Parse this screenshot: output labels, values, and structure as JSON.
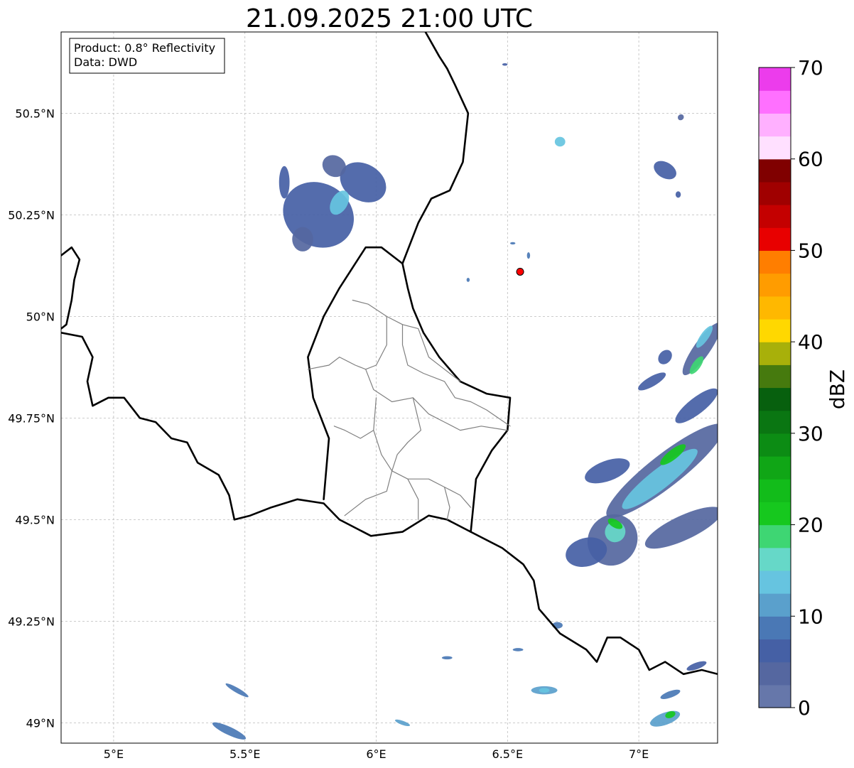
{
  "title": "21.09.2025 21:00 UTC",
  "info_box": {
    "product": "Product: 0.8° Reflectivity",
    "data": "Data: DWD"
  },
  "map": {
    "lon_range": [
      4.8,
      7.3
    ],
    "lat_range": [
      48.95,
      50.7
    ],
    "gridlines": true,
    "x_ticks": [
      {
        "value": 5.0,
        "label": "5°E"
      },
      {
        "value": 5.5,
        "label": "5.5°E"
      },
      {
        "value": 6.0,
        "label": "6°E"
      },
      {
        "value": 6.5,
        "label": "6.5°E"
      },
      {
        "value": 7.0,
        "label": "7°E"
      }
    ],
    "y_ticks": [
      {
        "value": 49.0,
        "label": "49°N"
      },
      {
        "value": 49.25,
        "label": "49.25°N"
      },
      {
        "value": 49.5,
        "label": "49.5°N"
      },
      {
        "value": 49.75,
        "label": "49.75°N"
      },
      {
        "value": 50.0,
        "label": "50°N"
      },
      {
        "value": 50.25,
        "label": "50.25°N"
      },
      {
        "value": 50.5,
        "label": "50.5°N"
      }
    ],
    "radar_site": {
      "lon": 6.548,
      "lat": 50.11,
      "color": "#ff0000"
    }
  },
  "colorbar": {
    "label": "dBZ",
    "min": 0,
    "max": 70,
    "ticks": [
      {
        "value": 0,
        "label": "0"
      },
      {
        "value": 10,
        "label": "10"
      },
      {
        "value": 20,
        "label": "20"
      },
      {
        "value": 30,
        "label": "30"
      },
      {
        "value": 40,
        "label": "40"
      },
      {
        "value": 50,
        "label": "50"
      },
      {
        "value": 60,
        "label": "60"
      },
      {
        "value": 70,
        "label": "70"
      }
    ],
    "colors": [
      "#6677aa",
      "#5567a0",
      "#4560a5",
      "#4a78b5",
      "#5aa0cc",
      "#66c4e0",
      "#66d8c8",
      "#3ed673",
      "#16c81e",
      "#12bc1a",
      "#10a616",
      "#0c8c14",
      "#0a7612",
      "#07600e",
      "#467a0e",
      "#a8b00a",
      "#ffd800",
      "#ffb800",
      "#ff9c00",
      "#ff7e00",
      "#e80000",
      "#c40000",
      "#a00000",
      "#800000",
      "#ffe0ff",
      "#ffb0ff",
      "#ff70ff",
      "#ec3cec"
    ]
  },
  "echoes": [
    {
      "lon": 5.78,
      "lat": 50.25,
      "rlon": 0.12,
      "rlat": 0.09,
      "angle": -60,
      "level": 2
    },
    {
      "lon": 5.95,
      "lat": 50.33,
      "rlon": 0.07,
      "rlat": 0.06,
      "angle": -60,
      "level": 2
    },
    {
      "lon": 5.84,
      "lat": 50.37,
      "rlon": 0.04,
      "rlat": 0.03,
      "angle": -60,
      "level": 1
    },
    {
      "lon": 5.86,
      "lat": 50.28,
      "rlon": 0.05,
      "rlat": 0.02,
      "angle": -60,
      "level": 5
    },
    {
      "lon": 5.65,
      "lat": 50.33,
      "rlon": 0.02,
      "rlat": 0.04,
      "angle": 0,
      "level": 2
    },
    {
      "lon": 5.72,
      "lat": 50.19,
      "rlon": 0.04,
      "rlat": 0.03,
      "angle": 0,
      "level": 1
    },
    {
      "lon": 7.1,
      "lat": 49.62,
      "rlon": 0.28,
      "rlat": 0.04,
      "angle": -38,
      "level": 1
    },
    {
      "lon": 7.22,
      "lat": 49.78,
      "rlon": 0.1,
      "rlat": 0.02,
      "angle": -38,
      "level": 2
    },
    {
      "lon": 7.08,
      "lat": 49.6,
      "rlon": 0.18,
      "rlat": 0.025,
      "angle": -38,
      "level": 5
    },
    {
      "lon": 7.13,
      "lat": 49.66,
      "rlon": 0.06,
      "rlat": 0.012,
      "angle": -38,
      "level": 8
    },
    {
      "lon": 7.24,
      "lat": 49.92,
      "rlon": 0.12,
      "rlat": 0.02,
      "angle": -55,
      "level": 1
    },
    {
      "lon": 7.25,
      "lat": 49.95,
      "rlon": 0.05,
      "rlat": 0.01,
      "angle": -55,
      "level": 5
    },
    {
      "lon": 7.22,
      "lat": 49.88,
      "rlon": 0.04,
      "rlat": 0.01,
      "angle": -55,
      "level": 7
    },
    {
      "lon": 6.9,
      "lat": 49.45,
      "rlon": 0.1,
      "rlat": 0.06,
      "angle": -55,
      "level": 1
    },
    {
      "lon": 6.91,
      "lat": 49.47,
      "rlon": 0.04,
      "rlat": 0.025,
      "angle": -60,
      "level": 6
    },
    {
      "lon": 6.91,
      "lat": 49.49,
      "rlon": 0.015,
      "rlat": 0.02,
      "angle": -60,
      "level": 8
    },
    {
      "lon": 6.8,
      "lat": 49.42,
      "rlon": 0.08,
      "rlat": 0.035,
      "angle": -15,
      "level": 2
    },
    {
      "lon": 6.88,
      "lat": 49.62,
      "rlon": 0.09,
      "rlat": 0.025,
      "angle": -20,
      "level": 2
    },
    {
      "lon": 7.17,
      "lat": 49.48,
      "rlon": 0.16,
      "rlat": 0.03,
      "angle": -25,
      "level": 1
    },
    {
      "lon": 7.05,
      "lat": 49.84,
      "rlon": 0.06,
      "rlat": 0.012,
      "angle": -30,
      "level": 2
    },
    {
      "lon": 7.1,
      "lat": 49.9,
      "rlon": 0.03,
      "rlat": 0.015,
      "angle": -50,
      "level": 2
    },
    {
      "lon": 7.1,
      "lat": 50.36,
      "rlon": 0.03,
      "rlat": 0.03,
      "angle": -60,
      "level": 2
    },
    {
      "lon": 7.16,
      "lat": 50.49,
      "rlon": 0.012,
      "rlat": 0.007,
      "angle": -40,
      "level": 1
    },
    {
      "lon": 7.15,
      "lat": 50.3,
      "rlon": 0.01,
      "rlat": 0.008,
      "angle": 0,
      "level": 2
    },
    {
      "lon": 6.7,
      "lat": 50.43,
      "rlon": 0.02,
      "rlat": 0.012,
      "angle": 0,
      "level": 5
    },
    {
      "lon": 6.64,
      "lat": 49.08,
      "rlon": 0.05,
      "rlat": 0.01,
      "angle": 0,
      "level": 4
    },
    {
      "lon": 6.64,
      "lat": 49.08,
      "rlon": 0.02,
      "rlat": 0.006,
      "angle": 0,
      "level": 5
    },
    {
      "lon": 6.69,
      "lat": 49.24,
      "rlon": 0.02,
      "rlat": 0.008,
      "angle": 0,
      "level": 3
    },
    {
      "lon": 6.54,
      "lat": 49.18,
      "rlon": 0.02,
      "rlat": 0.004,
      "angle": 0,
      "level": 3
    },
    {
      "lon": 6.27,
      "lat": 49.16,
      "rlon": 0.02,
      "rlat": 0.004,
      "angle": 0,
      "level": 3
    },
    {
      "lon": 6.1,
      "lat": 49.0,
      "rlon": 0.03,
      "rlat": 0.005,
      "angle": 20,
      "level": 4
    },
    {
      "lon": 5.47,
      "lat": 49.08,
      "rlon": 0.05,
      "rlat": 0.006,
      "angle": 30,
      "level": 3
    },
    {
      "lon": 5.44,
      "lat": 48.98,
      "rlon": 0.07,
      "rlat": 0.01,
      "angle": 25,
      "level": 3
    },
    {
      "lon": 7.1,
      "lat": 49.01,
      "rlon": 0.06,
      "rlat": 0.015,
      "angle": -20,
      "level": 4
    },
    {
      "lon": 7.12,
      "lat": 49.02,
      "rlon": 0.02,
      "rlat": 0.008,
      "angle": -20,
      "level": 8
    },
    {
      "lon": 7.12,
      "lat": 49.07,
      "rlon": 0.04,
      "rlat": 0.008,
      "angle": -20,
      "level": 3
    },
    {
      "lon": 7.22,
      "lat": 49.14,
      "rlon": 0.04,
      "rlat": 0.008,
      "angle": -20,
      "level": 2
    },
    {
      "lon": 6.52,
      "lat": 50.18,
      "rlon": 0.01,
      "rlat": 0.003,
      "angle": 0,
      "level": 3
    },
    {
      "lon": 6.58,
      "lat": 50.15,
      "rlon": 0.006,
      "rlat": 0.008,
      "angle": 0,
      "level": 3
    },
    {
      "lon": 6.35,
      "lat": 50.09,
      "rlon": 0.006,
      "rlat": 0.005,
      "angle": 0,
      "level": 3
    },
    {
      "lon": 6.49,
      "lat": 50.62,
      "rlon": 0.01,
      "rlat": 0.003,
      "angle": 0,
      "level": 2
    }
  ],
  "borders": [
    {
      "kind": "national",
      "points": [
        [
          4.8,
          49.96
        ],
        [
          4.88,
          49.95
        ],
        [
          4.92,
          49.9
        ],
        [
          4.9,
          49.84
        ],
        [
          4.92,
          49.78
        ],
        [
          4.98,
          49.8
        ],
        [
          5.04,
          49.8
        ],
        [
          5.1,
          49.75
        ],
        [
          5.16,
          49.74
        ],
        [
          5.22,
          49.7
        ],
        [
          5.28,
          49.69
        ],
        [
          5.32,
          49.64
        ],
        [
          5.4,
          49.61
        ],
        [
          5.44,
          49.56
        ],
        [
          5.46,
          49.5
        ],
        [
          5.52,
          49.51
        ],
        [
          5.6,
          49.53
        ],
        [
          5.7,
          49.55
        ],
        [
          5.8,
          49.54
        ],
        [
          5.86,
          49.5
        ],
        [
          5.98,
          49.46
        ],
        [
          6.1,
          49.47
        ],
        [
          6.2,
          49.51
        ],
        [
          6.27,
          49.5
        ],
        [
          6.36,
          49.47
        ],
        [
          6.48,
          49.43
        ],
        [
          6.56,
          49.39
        ],
        [
          6.6,
          49.35
        ],
        [
          6.62,
          49.28
        ],
        [
          6.7,
          49.22
        ],
        [
          6.8,
          49.18
        ],
        [
          6.84,
          49.15
        ],
        [
          6.88,
          49.21
        ],
        [
          6.93,
          49.21
        ],
        [
          7.0,
          49.18
        ],
        [
          7.04,
          49.13
        ],
        [
          7.1,
          49.15
        ],
        [
          7.17,
          49.12
        ],
        [
          7.24,
          49.13
        ],
        [
          7.3,
          49.12
        ]
      ]
    },
    {
      "kind": "national",
      "points": [
        [
          5.8,
          49.55
        ],
        [
          5.82,
          49.7
        ],
        [
          5.76,
          49.8
        ],
        [
          5.74,
          49.9
        ],
        [
          5.8,
          50.0
        ],
        [
          5.86,
          50.07
        ],
        [
          5.96,
          50.17
        ],
        [
          6.02,
          50.17
        ],
        [
          6.06,
          50.15
        ],
        [
          6.1,
          50.13
        ],
        [
          6.12,
          50.07
        ],
        [
          6.14,
          50.02
        ],
        [
          6.18,
          49.96
        ],
        [
          6.24,
          49.9
        ],
        [
          6.32,
          49.84
        ],
        [
          6.42,
          49.81
        ],
        [
          6.51,
          49.8
        ],
        [
          6.5,
          49.72
        ],
        [
          6.44,
          49.67
        ],
        [
          6.38,
          49.6
        ],
        [
          6.36,
          49.47
        ]
      ]
    },
    {
      "kind": "national",
      "points": [
        [
          6.1,
          50.13
        ],
        [
          6.16,
          50.23
        ],
        [
          6.21,
          50.29
        ],
        [
          6.28,
          50.31
        ],
        [
          6.33,
          50.38
        ],
        [
          6.35,
          50.5
        ],
        [
          6.3,
          50.57
        ],
        [
          6.27,
          50.61
        ],
        [
          6.24,
          50.64
        ],
        [
          6.17,
          50.72
        ]
      ]
    },
    {
      "kind": "national",
      "points": [
        [
          4.8,
          50.15
        ],
        [
          4.84,
          50.17
        ],
        [
          4.87,
          50.14
        ],
        [
          4.85,
          50.09
        ],
        [
          4.84,
          50.04
        ],
        [
          4.82,
          49.98
        ],
        [
          4.8,
          49.97
        ]
      ]
    },
    {
      "kind": "admin",
      "points": [
        [
          5.91,
          50.04
        ],
        [
          5.97,
          50.03
        ],
        [
          6.04,
          50.0
        ],
        [
          6.1,
          49.98
        ],
        [
          6.16,
          49.97
        ],
        [
          6.2,
          49.9
        ],
        [
          6.26,
          49.87
        ],
        [
          6.32,
          49.84
        ]
      ]
    },
    {
      "kind": "admin",
      "points": [
        [
          6.04,
          50.0
        ],
        [
          6.04,
          49.93
        ],
        [
          6.0,
          49.88
        ],
        [
          5.96,
          49.87
        ],
        [
          5.92,
          49.88
        ],
        [
          5.86,
          49.9
        ],
        [
          5.82,
          49.88
        ],
        [
          5.74,
          49.87
        ]
      ]
    },
    {
      "kind": "admin",
      "points": [
        [
          6.1,
          49.98
        ],
        [
          6.1,
          49.93
        ],
        [
          6.12,
          49.88
        ],
        [
          6.18,
          49.86
        ],
        [
          6.26,
          49.84
        ],
        [
          6.3,
          49.8
        ],
        [
          6.36,
          49.79
        ],
        [
          6.42,
          49.77
        ],
        [
          6.51,
          49.73
        ]
      ]
    },
    {
      "kind": "admin",
      "points": [
        [
          5.96,
          49.87
        ],
        [
          5.99,
          49.82
        ],
        [
          6.06,
          49.79
        ],
        [
          6.14,
          49.8
        ],
        [
          6.2,
          49.76
        ],
        [
          6.26,
          49.74
        ],
        [
          6.32,
          49.72
        ],
        [
          6.4,
          49.73
        ],
        [
          6.5,
          49.72
        ]
      ]
    },
    {
      "kind": "admin",
      "points": [
        [
          6.0,
          49.8
        ],
        [
          5.99,
          49.72
        ],
        [
          5.94,
          49.7
        ],
        [
          5.88,
          49.72
        ],
        [
          5.84,
          49.73
        ]
      ]
    },
    {
      "kind": "admin",
      "points": [
        [
          5.99,
          49.72
        ],
        [
          6.02,
          49.66
        ],
        [
          6.06,
          49.62
        ],
        [
          6.04,
          49.57
        ],
        [
          5.96,
          49.55
        ],
        [
          5.88,
          49.51
        ]
      ]
    },
    {
      "kind": "admin",
      "points": [
        [
          6.06,
          49.62
        ],
        [
          6.12,
          49.6
        ],
        [
          6.2,
          49.6
        ],
        [
          6.26,
          49.58
        ],
        [
          6.32,
          49.56
        ],
        [
          6.36,
          49.53
        ]
      ]
    },
    {
      "kind": "admin",
      "points": [
        [
          6.14,
          49.8
        ],
        [
          6.17,
          49.72
        ],
        [
          6.12,
          49.69
        ],
        [
          6.08,
          49.66
        ],
        [
          6.06,
          49.62
        ]
      ]
    },
    {
      "kind": "admin",
      "points": [
        [
          6.12,
          49.6
        ],
        [
          6.16,
          49.55
        ],
        [
          6.16,
          49.5
        ]
      ]
    },
    {
      "kind": "admin",
      "points": [
        [
          6.26,
          49.58
        ],
        [
          6.28,
          49.53
        ],
        [
          6.27,
          49.5
        ]
      ]
    }
  ]
}
